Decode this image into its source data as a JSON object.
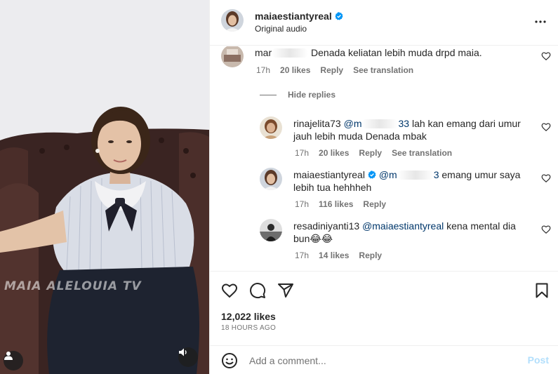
{
  "media": {
    "watermark": "MAIA ALELOUIA TV"
  },
  "header": {
    "username": "maiaestiantyreal",
    "audio": "Original audio"
  },
  "comments": [
    {
      "user": "mar",
      "text": "Denada keliatan lebih muda drpd maia.",
      "time": "17h",
      "likes": "20 likes",
      "reply": "Reply",
      "translate": "See translation"
    }
  ],
  "hide_replies": "Hide replies",
  "replies": [
    {
      "user": "rinajelita73",
      "mention": "@m",
      "mention_tail": "33",
      "text_line1": "lah kan emang dari umur",
      "text_line2": "jauh lebih muda Denada mbak",
      "time": "17h",
      "likes": "20 likes",
      "reply": "Reply",
      "translate": "See translation"
    },
    {
      "user": "maiaestiantyreal",
      "mention": "@m",
      "mention_tail": "3",
      "text_line1": "emang umur saya",
      "text_line2": "lebih tua hehhheh",
      "time": "17h",
      "likes": "116 likes",
      "reply": "Reply"
    },
    {
      "user": "resadiniyanti13",
      "mention": "@maiaestiantyreal",
      "text_line1": "kena mental dia",
      "text_line2": "bun😂😂",
      "time": "17h",
      "likes": "14 likes",
      "reply": "Reply"
    }
  ],
  "actions": {
    "icons": [
      "heart-icon",
      "comment-icon",
      "share-icon",
      "bookmark-icon"
    ],
    "likes": "12,022 likes",
    "date": "18 HOURS AGO"
  },
  "add_comment": {
    "placeholder": "Add a comment...",
    "post_label": "Post"
  },
  "colors": {
    "verified": "#0095f6",
    "mention": "#00376b",
    "muted": "#737373",
    "post_disabled": "#b2dffc"
  }
}
